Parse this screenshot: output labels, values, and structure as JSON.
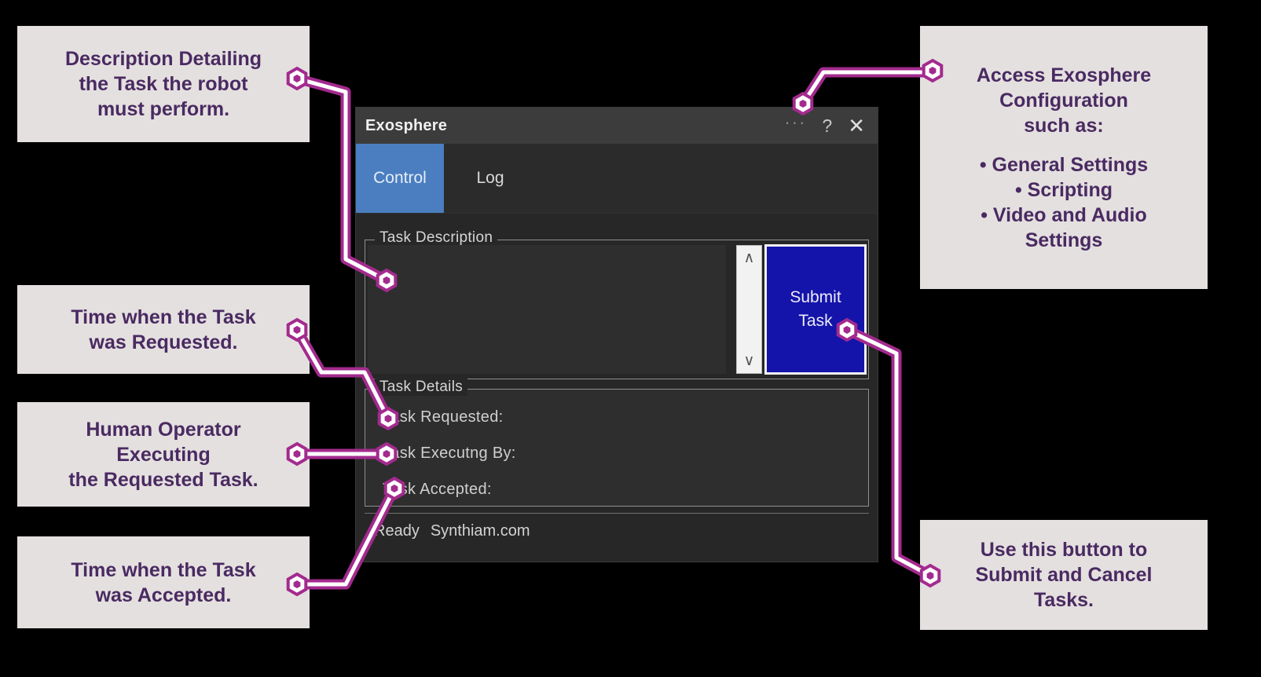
{
  "window": {
    "title": "Exosphere",
    "titlebar_buttons": [
      {
        "name": "more-options",
        "glyph": "···"
      },
      {
        "name": "help",
        "glyph": "?"
      },
      {
        "name": "close",
        "glyph": "✕"
      }
    ],
    "tabs": [
      {
        "label": "Control",
        "active": true
      },
      {
        "label": "Log",
        "active": false
      }
    ],
    "task_description": {
      "legend": "Task Description",
      "input_value": "",
      "input_placeholder": "",
      "scroll_up_glyph": "∧",
      "scroll_down_glyph": "∨",
      "submit_button_line1": "Submit",
      "submit_button_line2": "Task"
    },
    "task_details": {
      "legend": "Task Details",
      "rows": [
        {
          "label": "Task Requested:",
          "value": ""
        },
        {
          "label": "Task Executng By:",
          "value": ""
        },
        {
          "label": "Task Accepted:",
          "value": ""
        }
      ]
    },
    "status_bar": {
      "ready": "Ready",
      "site": "Synthiam.com"
    }
  },
  "callouts": {
    "description": {
      "lines": [
        "Description Detailing",
        "the Task the robot",
        "must perform."
      ]
    },
    "requested": {
      "lines": [
        "Time when the Task",
        "was Requested."
      ]
    },
    "operator": {
      "lines": [
        "Human Operator",
        "Executing",
        "the Requested Task."
      ]
    },
    "accepted": {
      "lines": [
        "Time when the Task",
        "was Accepted."
      ]
    },
    "configuration": {
      "heading_lines": [
        "Access Exosphere",
        "Configuration",
        "such as:"
      ],
      "bullets": [
        "• General Settings",
        "• Scripting",
        "• Video and Audio",
        "Settings"
      ]
    },
    "submit": {
      "lines": [
        "Use this button to",
        "Submit and Cancel",
        "Tasks."
      ]
    }
  },
  "colors": {
    "background": "#000000",
    "callout_bg": "#e4e0df",
    "callout_text": "#4a2a62",
    "connector_outline": "#a32a8e",
    "connector_core": "#ffffff",
    "accent_tab": "#4a7ec0",
    "submit_button": "#1414aa",
    "window_bg": "#272727",
    "titlebar_bg": "#3c3c3c"
  }
}
